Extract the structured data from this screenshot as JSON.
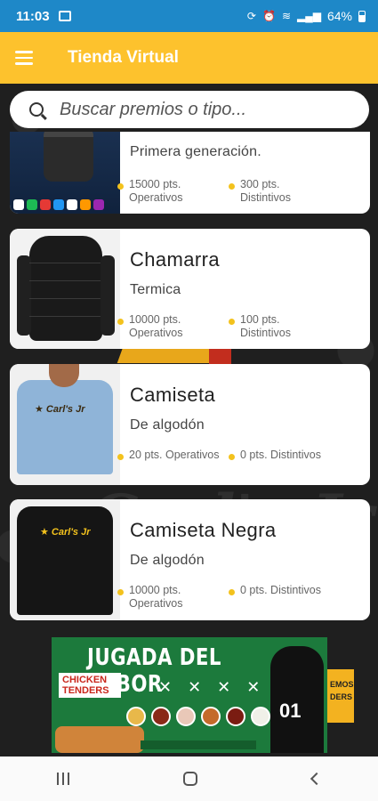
{
  "status_bar": {
    "time": "11:03",
    "battery": "64%"
  },
  "app_bar": {
    "title": "Tienda Virtual"
  },
  "search": {
    "placeholder": "Buscar premios o tipo..."
  },
  "products": [
    {
      "title": "",
      "subtitle": "Primera generación.",
      "operativos": "15000 pts. Operativos",
      "distintivos": "300 pts. Distintivos",
      "image": "smart-speaker"
    },
    {
      "title": "Chamarra",
      "subtitle": "Termica",
      "operativos": "10000 pts. Operativos",
      "distintivos": "100 pts. Distintivos",
      "image": "jacket"
    },
    {
      "title": "Camiseta",
      "subtitle": "De algodón",
      "operativos": "20 pts. Operativos",
      "distintivos": "0 pts. Distintivos",
      "image": "blue-tshirt"
    },
    {
      "title": "Camiseta Negra",
      "subtitle": "De algodón",
      "operativos": "10000 pts. Operativos",
      "distintivos": "0 pts. Distintivos",
      "image": "black-tshirt"
    }
  ],
  "banner": {
    "headline": "JUGADA DEL SABOR",
    "product": "CHICKEN TENDERS",
    "jersey_number": "01",
    "side_tab": "EMOS DERS"
  },
  "colors": {
    "status_bar": "#1e88c8",
    "app_bar": "#fdc22d",
    "point_dot": "#f3c21d"
  }
}
